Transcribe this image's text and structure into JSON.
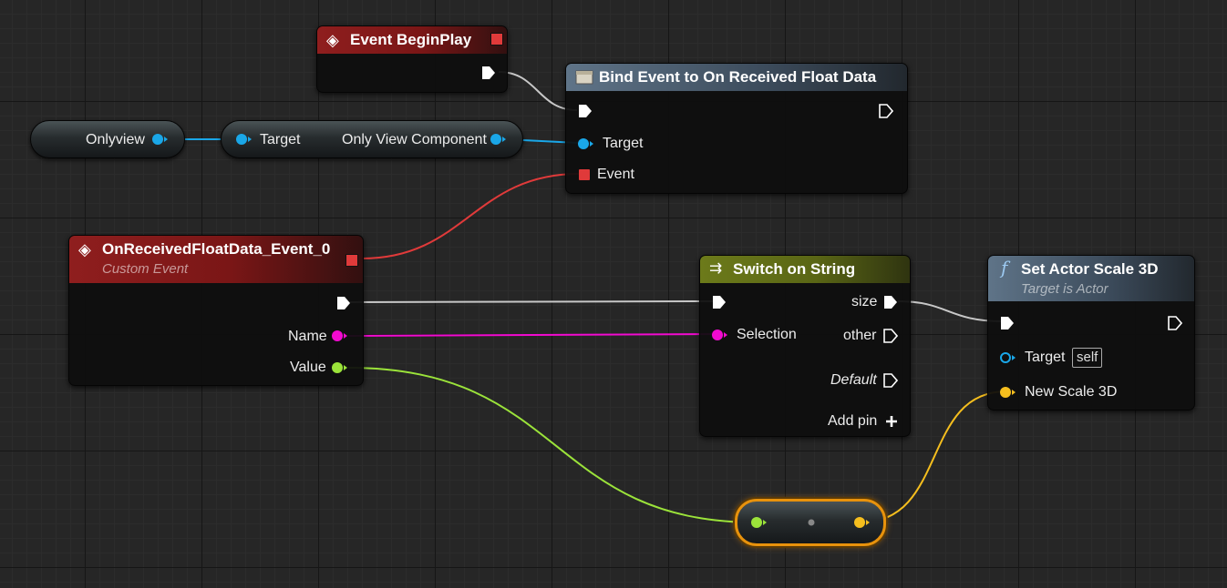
{
  "nodes": {
    "begin_play": {
      "title": "Event BeginPlay"
    },
    "bind_event": {
      "title": "Bind Event to On Received Float Data",
      "pin_target": "Target",
      "pin_event": "Event"
    },
    "onlyview_var": {
      "label": "Onlyview"
    },
    "only_view_component": {
      "pin_target": "Target",
      "output": "Only View Component"
    },
    "custom_event": {
      "title": "OnReceivedFloatData_Event_0",
      "subtitle": "Custom Event",
      "pin_name": "Name",
      "pin_value": "Value"
    },
    "switch": {
      "title": "Switch on String",
      "pin_size": "size",
      "pin_selection": "Selection",
      "pin_other": "other",
      "pin_default": "Default",
      "add_pin": "Add pin"
    },
    "set_scale": {
      "title": "Set Actor Scale 3D",
      "subtitle": "Target is Actor",
      "pin_target": "Target",
      "self_value": "self",
      "pin_new_scale": "New Scale 3D"
    }
  },
  "colors": {
    "exec_wire": "#c8c8c8",
    "object_pin": "#1aa7e8",
    "delegate_pin": "#e03a3a",
    "string_pin": "#f20ad0",
    "float_pin": "#9be33a",
    "vector_pin": "#f5be1e",
    "reroute_outline": "#e8920c"
  },
  "icons": {
    "event": "diamond-event-icon",
    "bind": "delegate-bind-icon",
    "switch": "switch-icon",
    "function": "function-f-icon"
  }
}
